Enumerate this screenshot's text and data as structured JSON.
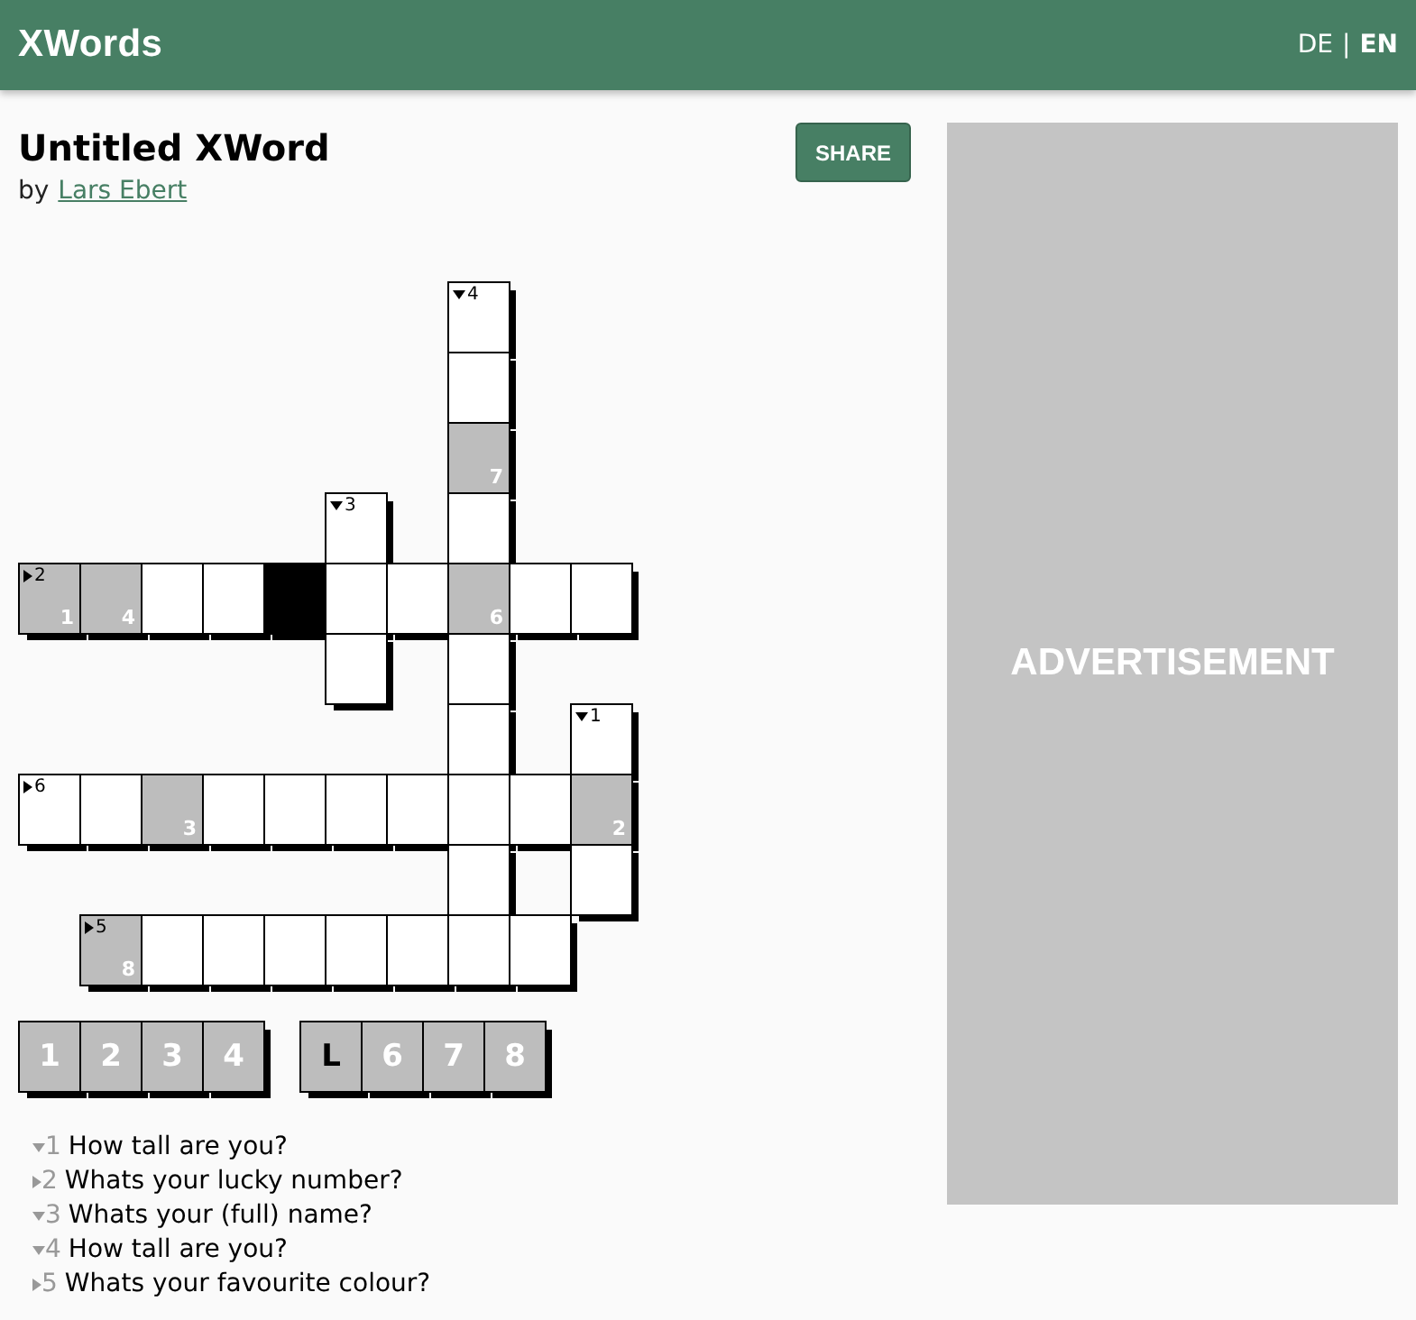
{
  "header": {
    "logo": "XWords",
    "languages": [
      {
        "label": "DE",
        "selected": false
      },
      {
        "label": "EN",
        "selected": true
      }
    ],
    "separator": "|"
  },
  "puzzle": {
    "title": "Untitled XWord",
    "byline": "by",
    "author": "Lars Ebert",
    "share": "SHARE"
  },
  "grid": {
    "rows": [
      [
        {
          "kind": "gap"
        },
        {
          "kind": "gap"
        },
        {
          "kind": "gap"
        },
        {
          "kind": "gap"
        },
        {
          "kind": "gap"
        },
        {
          "kind": "gap"
        },
        {
          "kind": "gap"
        },
        {
          "kind": "cell",
          "clue": "4",
          "across": false
        },
        {
          "kind": "gap"
        },
        {
          "kind": "gap"
        }
      ],
      [
        {
          "kind": "gap"
        },
        {
          "kind": "gap"
        },
        {
          "kind": "gap"
        },
        {
          "kind": "gap"
        },
        {
          "kind": "gap"
        },
        {
          "kind": "gap"
        },
        {
          "kind": "gap"
        },
        {
          "kind": "cell"
        },
        {
          "kind": "gap"
        },
        {
          "kind": "gap"
        }
      ],
      [
        {
          "kind": "gap"
        },
        {
          "kind": "gap"
        },
        {
          "kind": "gap"
        },
        {
          "kind": "gap"
        },
        {
          "kind": "gap"
        },
        {
          "kind": "gap"
        },
        {
          "kind": "gap"
        },
        {
          "kind": "cell",
          "shaded": true,
          "index": "7"
        },
        {
          "kind": "gap"
        },
        {
          "kind": "gap"
        }
      ],
      [
        {
          "kind": "gap"
        },
        {
          "kind": "gap"
        },
        {
          "kind": "gap"
        },
        {
          "kind": "gap"
        },
        {
          "kind": "gap"
        },
        {
          "kind": "cell",
          "clue": "3",
          "across": false
        },
        {
          "kind": "gap"
        },
        {
          "kind": "cell"
        },
        {
          "kind": "gap"
        },
        {
          "kind": "gap"
        }
      ],
      [
        {
          "kind": "cell",
          "clue": "2",
          "across": true,
          "shaded": true,
          "index": "1"
        },
        {
          "kind": "cell",
          "shaded": true,
          "index": "4"
        },
        {
          "kind": "cell"
        },
        {
          "kind": "cell"
        },
        {
          "kind": "block"
        },
        {
          "kind": "cell"
        },
        {
          "kind": "cell"
        },
        {
          "kind": "cell",
          "shaded": true,
          "index": "6"
        },
        {
          "kind": "cell"
        },
        {
          "kind": "cell"
        }
      ],
      [
        {
          "kind": "gap"
        },
        {
          "kind": "gap"
        },
        {
          "kind": "gap"
        },
        {
          "kind": "gap"
        },
        {
          "kind": "gap"
        },
        {
          "kind": "cell"
        },
        {
          "kind": "gap"
        },
        {
          "kind": "cell"
        },
        {
          "kind": "gap"
        },
        {
          "kind": "gap"
        }
      ],
      [
        {
          "kind": "gap"
        },
        {
          "kind": "gap"
        },
        {
          "kind": "gap"
        },
        {
          "kind": "gap"
        },
        {
          "kind": "gap"
        },
        {
          "kind": "gap"
        },
        {
          "kind": "gap"
        },
        {
          "kind": "cell"
        },
        {
          "kind": "gap"
        },
        {
          "kind": "cell",
          "clue": "1",
          "across": false
        }
      ],
      [
        {
          "kind": "cell",
          "clue": "6",
          "across": true
        },
        {
          "kind": "cell"
        },
        {
          "kind": "cell",
          "shaded": true,
          "index": "3"
        },
        {
          "kind": "cell"
        },
        {
          "kind": "cell"
        },
        {
          "kind": "cell"
        },
        {
          "kind": "cell"
        },
        {
          "kind": "cell"
        },
        {
          "kind": "cell"
        },
        {
          "kind": "cell",
          "shaded": true,
          "index": "2"
        }
      ],
      [
        {
          "kind": "gap"
        },
        {
          "kind": "gap"
        },
        {
          "kind": "gap"
        },
        {
          "kind": "gap"
        },
        {
          "kind": "gap"
        },
        {
          "kind": "gap"
        },
        {
          "kind": "gap"
        },
        {
          "kind": "cell"
        },
        {
          "kind": "gap"
        },
        {
          "kind": "cell"
        }
      ],
      [
        {
          "kind": "gap"
        },
        {
          "kind": "cell",
          "clue": "5",
          "across": true,
          "shaded": true,
          "index": "8"
        },
        {
          "kind": "cell"
        },
        {
          "kind": "cell"
        },
        {
          "kind": "cell"
        },
        {
          "kind": "cell"
        },
        {
          "kind": "cell"
        },
        {
          "kind": "cell"
        },
        {
          "kind": "cell"
        },
        {
          "kind": "gap"
        }
      ]
    ]
  },
  "solution": [
    [
      {
        "text": "1",
        "filled": false
      },
      {
        "text": "2",
        "filled": false
      },
      {
        "text": "3",
        "filled": false
      },
      {
        "text": "4",
        "filled": false
      }
    ],
    [
      {
        "text": "L",
        "filled": true
      },
      {
        "text": "6",
        "filled": false
      },
      {
        "text": "7",
        "filled": false
      },
      {
        "text": "8",
        "filled": false
      }
    ]
  ],
  "clues": [
    {
      "number": "1",
      "across": false,
      "text": "How tall are you?"
    },
    {
      "number": "2",
      "across": true,
      "text": "Whats your lucky number?"
    },
    {
      "number": "3",
      "across": false,
      "text": "Whats your (full) name?"
    },
    {
      "number": "4",
      "across": false,
      "text": "How tall are you?"
    },
    {
      "number": "5",
      "across": true,
      "text": "Whats your favourite colour?"
    }
  ],
  "ad": {
    "label": "ADVERTISEMENT"
  }
}
